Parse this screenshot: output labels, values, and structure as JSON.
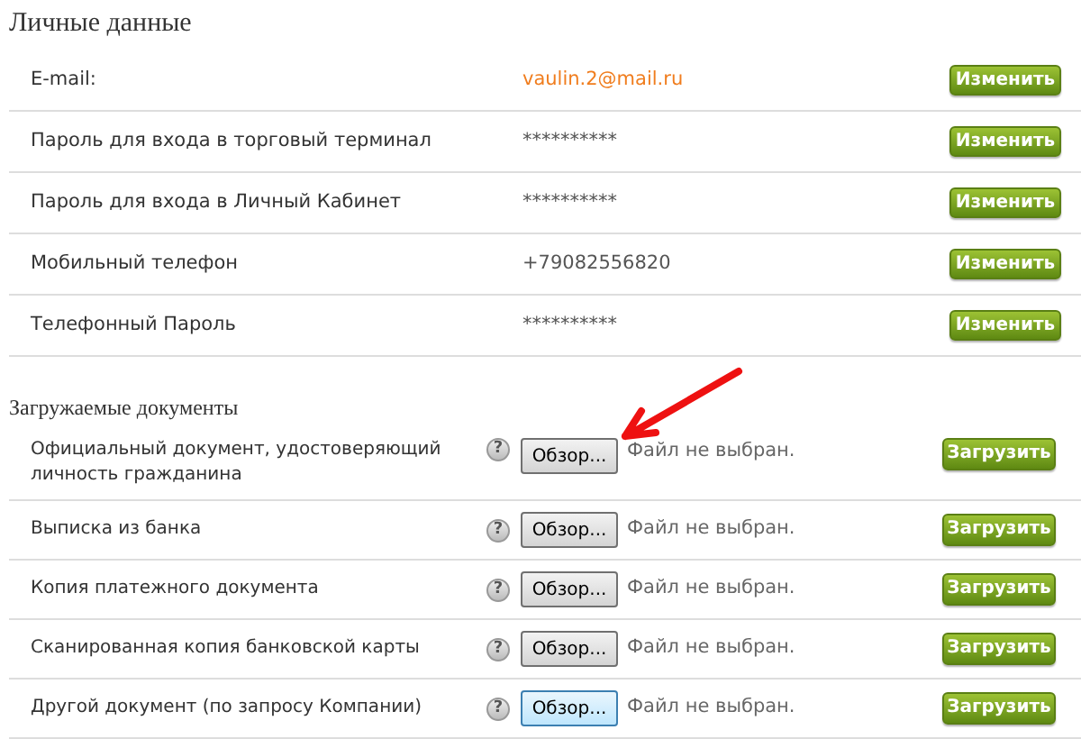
{
  "personal": {
    "title": "Личные данные",
    "rows": [
      {
        "label": "E-mail:",
        "value": "vaulin.2@mail.ru",
        "kind": "link",
        "button": "Изменить"
      },
      {
        "label": "Пароль для входа в торговый терминал",
        "value": "**********",
        "kind": "text",
        "button": "Изменить"
      },
      {
        "label": "Пароль для входа в Личный Кабинет",
        "value": "**********",
        "kind": "text",
        "button": "Изменить"
      },
      {
        "label": "Мобильный телефон",
        "value": "+79082556820",
        "kind": "text",
        "button": "Изменить"
      },
      {
        "label": "Телефонный Пароль",
        "value": "**********",
        "kind": "text",
        "button": "Изменить"
      }
    ]
  },
  "documents": {
    "title": "Загружаемые документы",
    "rows": [
      {
        "label": "Официальный документ, удостоверяющий личность гражданина",
        "help": "?",
        "browse": "Обзор...",
        "file": "Файл не выбран.",
        "upload": "Загрузить",
        "hovered": false,
        "arrow": true
      },
      {
        "label": "Выписка из банка",
        "help": "?",
        "browse": "Обзор...",
        "file": "Файл не выбран.",
        "upload": "Загрузить",
        "hovered": false,
        "arrow": false
      },
      {
        "label": "Копия платежного документа",
        "help": "?",
        "browse": "Обзор...",
        "file": "Файл не выбран.",
        "upload": "Загрузить",
        "hovered": false,
        "arrow": false
      },
      {
        "label": "Сканированная копия банковской карты",
        "help": "?",
        "browse": "Обзор...",
        "file": "Файл не выбран.",
        "upload": "Загрузить",
        "hovered": false,
        "arrow": false
      },
      {
        "label": "Другой документ (по запросу Компании)",
        "help": "?",
        "browse": "Обзор...",
        "file": "Файл не выбран.",
        "upload": "Загрузить",
        "hovered": true,
        "arrow": false
      }
    ]
  }
}
